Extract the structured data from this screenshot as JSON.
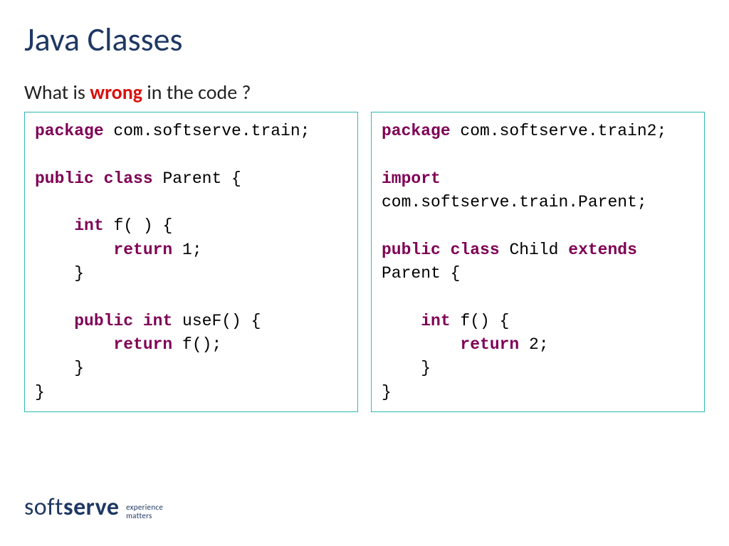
{
  "title": "Java Classes",
  "subtitle_pre": "What is ",
  "subtitle_wrong": "wrong",
  "subtitle_post": " in the code ?",
  "code_left": {
    "tokens": [
      {
        "t": "package ",
        "c": "kw"
      },
      {
        "t": "com.softserve.train;",
        "c": "pkgname"
      },
      {
        "t": "\n\n"
      },
      {
        "t": "public class ",
        "c": "kw"
      },
      {
        "t": "Parent {",
        "c": "pkgname"
      },
      {
        "t": "\n\n"
      },
      {
        "t": "    "
      },
      {
        "t": "int ",
        "c": "kw"
      },
      {
        "t": "f( ) {",
        "c": "pkgname"
      },
      {
        "t": "\n"
      },
      {
        "t": "        "
      },
      {
        "t": "return ",
        "c": "kw"
      },
      {
        "t": "1;",
        "c": "pkgname"
      },
      {
        "t": "\n"
      },
      {
        "t": "    }",
        "c": "pkgname"
      },
      {
        "t": "\n\n"
      },
      {
        "t": "    "
      },
      {
        "t": "public int ",
        "c": "kw"
      },
      {
        "t": "useF() {",
        "c": "pkgname"
      },
      {
        "t": "\n"
      },
      {
        "t": "        "
      },
      {
        "t": "return ",
        "c": "kw"
      },
      {
        "t": "f();",
        "c": "pkgname"
      },
      {
        "t": "\n"
      },
      {
        "t": "    }",
        "c": "pkgname"
      },
      {
        "t": "\n"
      },
      {
        "t": "}",
        "c": "pkgname"
      }
    ]
  },
  "code_right": {
    "tokens": [
      {
        "t": "package ",
        "c": "kw"
      },
      {
        "t": "com.softserve.train2;",
        "c": "pkgname"
      },
      {
        "t": "\n\n"
      },
      {
        "t": "import",
        "c": "kw"
      },
      {
        "t": "\n"
      },
      {
        "t": "com.softserve.train.Parent;",
        "c": "pkgname"
      },
      {
        "t": "\n\n"
      },
      {
        "t": "public class ",
        "c": "kw"
      },
      {
        "t": "Child ",
        "c": "pkgname"
      },
      {
        "t": "extends",
        "c": "kw"
      },
      {
        "t": "\n"
      },
      {
        "t": "Parent {",
        "c": "pkgname"
      },
      {
        "t": "\n\n"
      },
      {
        "t": "    "
      },
      {
        "t": "int ",
        "c": "kw"
      },
      {
        "t": "f() {",
        "c": "pkgname"
      },
      {
        "t": "\n"
      },
      {
        "t": "        "
      },
      {
        "t": "return ",
        "c": "kw"
      },
      {
        "t": "2;",
        "c": "pkgname"
      },
      {
        "t": "\n"
      },
      {
        "t": "    }",
        "c": "pkgname"
      },
      {
        "t": "\n"
      },
      {
        "t": "}",
        "c": "pkgname"
      }
    ]
  },
  "footer": {
    "soft": "soft",
    "serve": "serve",
    "tag1": "experience",
    "tag2": "matters"
  }
}
